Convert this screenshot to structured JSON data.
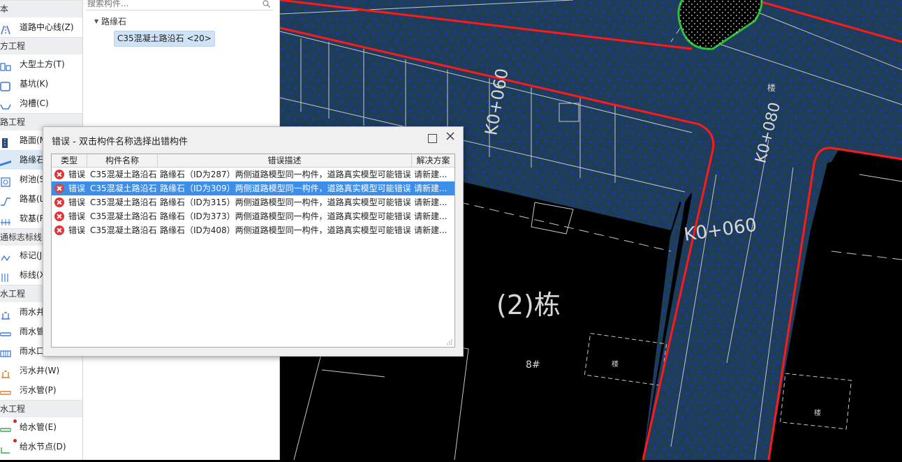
{
  "category_panel": {
    "items": [
      {
        "kind": "header",
        "label": "本"
      },
      {
        "kind": "item",
        "label": "道路中心线(Z)",
        "icon": "centerline-icon"
      },
      {
        "kind": "header",
        "label": "方工程"
      },
      {
        "kind": "item",
        "label": "大型土方(T)",
        "icon": "earthwork-icon"
      },
      {
        "kind": "item",
        "label": "基坑(K)",
        "icon": "pit-icon"
      },
      {
        "kind": "item",
        "label": "沟槽(C)",
        "icon": "trench-icon"
      },
      {
        "kind": "header",
        "label": "路工程"
      },
      {
        "kind": "item",
        "label": "路面(M)",
        "icon": "pavement-icon"
      },
      {
        "kind": "item",
        "label": "路缘石",
        "icon": "curb-icon",
        "active": true
      },
      {
        "kind": "item",
        "label": "树池(S)",
        "icon": "tree-pool-icon"
      },
      {
        "kind": "item",
        "label": "路基(L)",
        "icon": "subgrade-icon"
      },
      {
        "kind": "item",
        "label": "软基(R)",
        "icon": "soft-base-icon"
      },
      {
        "kind": "header",
        "label": "通标志标线"
      },
      {
        "kind": "item",
        "label": "标记(J)",
        "icon": "marking-icon"
      },
      {
        "kind": "item",
        "label": "标线(X)",
        "icon": "line-marking-icon"
      },
      {
        "kind": "header",
        "label": "水工程"
      },
      {
        "kind": "item",
        "label": "雨水井",
        "icon": "rain-well-icon"
      },
      {
        "kind": "item",
        "label": "雨水管",
        "icon": "rain-pipe-icon"
      },
      {
        "kind": "item",
        "label": "雨水口(S)",
        "icon": "rain-inlet-icon"
      },
      {
        "kind": "item",
        "label": "污水井(W)",
        "icon": "sewage-well-icon"
      },
      {
        "kind": "item",
        "label": "污水管(P)",
        "icon": "sewage-pipe-icon"
      },
      {
        "kind": "header",
        "label": "水工程"
      },
      {
        "kind": "item",
        "label": "给水管(E)",
        "icon": "water-pipe-icon",
        "dot": true
      },
      {
        "kind": "item",
        "label": "给水节点(D)",
        "icon": "water-node-icon",
        "dot": true
      }
    ]
  },
  "tree_panel": {
    "search_placeholder": "搜索构件...",
    "root_label": "路缘石",
    "child_label": "C35混凝土路沿石 <20>"
  },
  "cad": {
    "labels": {
      "k0_060_top": "K0+060",
      "k0_080": "K0+080",
      "k0_060_mid": "K0+060",
      "building": "(2)栋",
      "house_mark": "8#",
      "small_1": "楼",
      "small_2": "楼",
      "small_3": "楼"
    }
  },
  "dialog": {
    "title": "错误 - 双击构件名称选择出错构件",
    "columns": [
      "类型",
      "构件名称",
      "错误描述",
      "解决方案"
    ],
    "rows": [
      {
        "type": "错误",
        "name": "C35混凝土路沿石",
        "desc": "路缘石（ID为287）两侧道路模型同一构件，道路真实模型可能错误",
        "solution": "请新建..."
      },
      {
        "type": "错误",
        "name": "C35混凝土路沿石",
        "desc": "路缘石（ID为309）两侧道路模型同一构件，道路真实模型可能错误",
        "solution": "请新建...",
        "selected": true
      },
      {
        "type": "错误",
        "name": "C35混凝土路沿石",
        "desc": "路缘石（ID为315）两侧道路模型同一构件，道路真实模型可能错误",
        "solution": "请新建..."
      },
      {
        "type": "错误",
        "name": "C35混凝土路沿石",
        "desc": "路缘石（ID为373）两侧道路模型同一构件，道路真实模型可能错误",
        "solution": "请新建..."
      },
      {
        "type": "错误",
        "name": "C35混凝土路沿石",
        "desc": "路缘石（ID为408）两侧道路模型同一构件，道路真实模型可能错误",
        "solution": "请新建..."
      }
    ]
  },
  "colors": {
    "road_fill": "#1e3d57",
    "curb_red": "#ff1a1a",
    "island_green": "#2fbf3a",
    "dot_blue": "#1a2cff",
    "cad_line": "#c8c8c8",
    "selection": "#3d8ee8"
  }
}
